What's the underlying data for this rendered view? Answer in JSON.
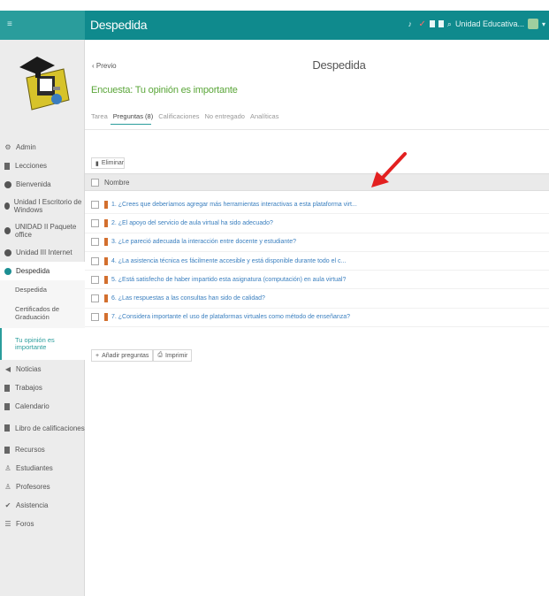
{
  "header": {
    "title": "Despedida",
    "school_label": "Unidad Educativa...",
    "colors": {
      "teal_bar": "#0f8a8d",
      "sidebar_top": "#2a9d9c",
      "survey_green": "#5ba63a",
      "link_blue": "#3a7fbf"
    }
  },
  "sidebar": {
    "items": [
      {
        "label": "Admin",
        "icon": "gear-icon"
      },
      {
        "label": "Lecciones",
        "icon": "book-icon"
      },
      {
        "label": "Bienvenida",
        "icon": "circle-icon"
      },
      {
        "label": "Unidad I Escritorio de Windows",
        "icon": "circle-icon"
      },
      {
        "label": "UNIDAD II Paquete office",
        "icon": "circle-icon"
      },
      {
        "label": "Unidad III Internet",
        "icon": "circle-icon"
      },
      {
        "label": "Despedida",
        "icon": "circle-icon"
      }
    ],
    "sub_items": [
      {
        "label": "Despedida"
      },
      {
        "label": "Certificados de Graduación"
      },
      {
        "label": "Tu opinión es importante"
      }
    ],
    "lower_items": [
      {
        "label": "Noticias",
        "icon": "megaphone-icon"
      },
      {
        "label": "Trabajos",
        "icon": "document-icon"
      },
      {
        "label": "Calendario",
        "icon": "calendar-icon"
      },
      {
        "label": "Libro de calificaciones",
        "icon": "gradebook-icon"
      },
      {
        "label": "Recursos",
        "icon": "folder-icon"
      },
      {
        "label": "Estudiantes",
        "icon": "user-icon"
      },
      {
        "label": "Profesores",
        "icon": "user-icon"
      },
      {
        "label": "Asistencia",
        "icon": "check-icon"
      },
      {
        "label": "Foros",
        "icon": "forum-icon"
      }
    ]
  },
  "main": {
    "back_label": "Previo",
    "page_title": "Despedida",
    "survey_title": "Encuesta: Tu opinión es importante",
    "tabs": [
      {
        "label": "Tarea"
      },
      {
        "label": "Preguntas (8)"
      },
      {
        "label": "Calificaciones"
      },
      {
        "label": "No entregado"
      },
      {
        "label": "Analíticas"
      }
    ],
    "delete_label": "Eliminar",
    "column_header": "Nombre",
    "questions": [
      "1. ¿Crees que deberíamos agregar más herramientas interactivas a esta plataforma virt...",
      "2. ¿El apoyo del servicio de aula virtual ha sido adecuado?",
      "3. ¿Le pareció adecuada la interacción entre docente y estudiante?",
      "4. ¿La asistencia técnica es fácilmente accesible y está disponible durante todo el c...",
      "5. ¿Está satisfecho de haber impartido esta asignatura (computación) en aula virtual?",
      "6. ¿Las respuestas a las consultas han sido de calidad?",
      "7. ¿Considera importante el uso de plataformas virtuales como método de enseñanza?"
    ],
    "add_questions_label": "Añadir preguntas",
    "print_label": "Imprimir"
  }
}
